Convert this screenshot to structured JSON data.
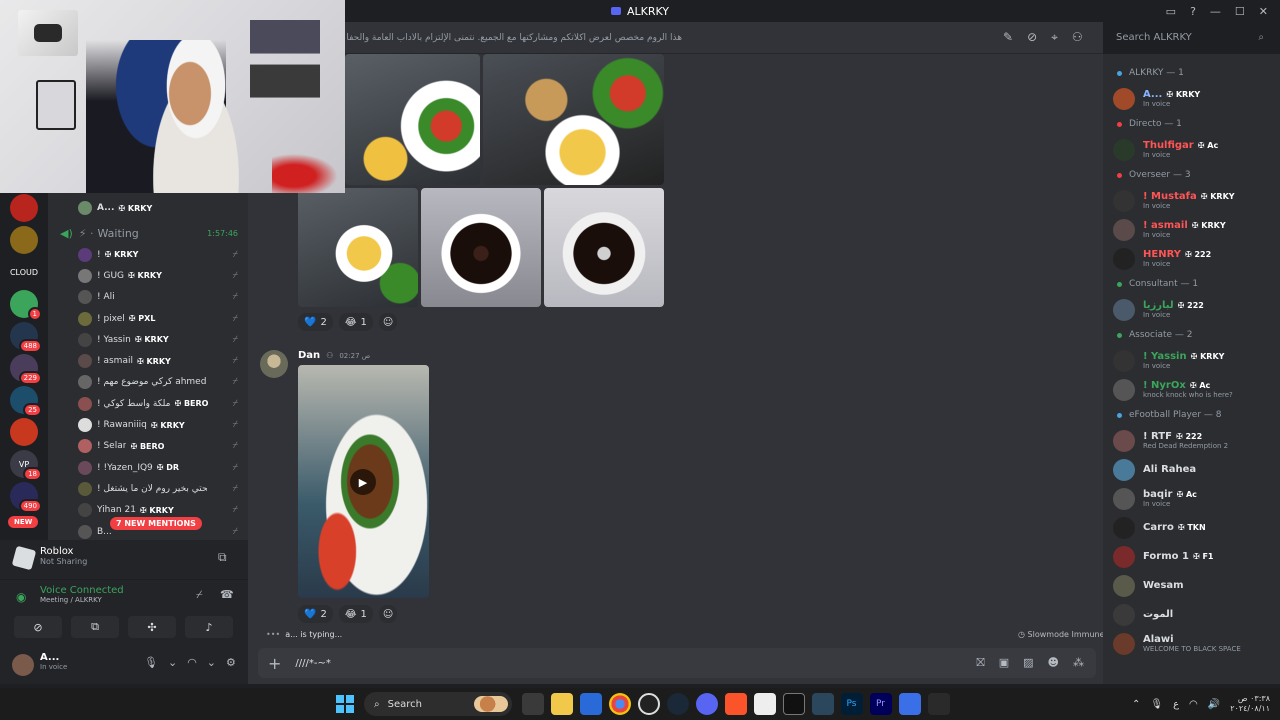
{
  "window": {
    "title": "ALKRKY"
  },
  "header": {
    "topic": "هذا الروم مخصص لعرض أكلاتكم ومشاركتها مع الجميع. نتمنى الإلتزام بالآداب العامة والحفاظ على جودة المحتوى.",
    "search_placeholder": "Search ALKRKY"
  },
  "guilds": [
    {
      "label": "",
      "badge": "",
      "color": "#b8241e"
    },
    {
      "label": "",
      "badge": "",
      "color": "#8a6a1a"
    },
    {
      "label": "CLOUD",
      "badge": "",
      "color": "#1e1f22"
    },
    {
      "label": "",
      "badge": "1",
      "color": "#3ba55c"
    },
    {
      "label": "",
      "badge": "488",
      "color": "#24354e"
    },
    {
      "label": "",
      "badge": "229",
      "color": "#4a3d5c"
    },
    {
      "label": "",
      "badge": "25",
      "color": "#1c4d6b"
    },
    {
      "label": "",
      "badge": "",
      "color": "#c8381e"
    },
    {
      "label": "VP",
      "badge": "18",
      "color": "#3b3b48"
    },
    {
      "label": "",
      "badge": "490",
      "color": "#2a2a5a"
    }
  ],
  "new_pill": "NEW",
  "mentions_pill": "7 NEW MENTIONS",
  "voice_channel": {
    "top_user": {
      "name": "A...",
      "tag": "KRKY"
    },
    "name": "Waiting",
    "timer": "1:57:46",
    "members": [
      {
        "name": "!",
        "tag": "KRKY",
        "color": "#5c3b7a"
      },
      {
        "name": "! GUG",
        "tag": "KRKY",
        "color": "#777"
      },
      {
        "name": "! Ali",
        "tag": "",
        "color": "#555"
      },
      {
        "name": "! pixel",
        "tag": "PXL",
        "color": "#6b6b3b"
      },
      {
        "name": "! Yassin",
        "tag": "KRKY",
        "color": "#444"
      },
      {
        "name": "! asmail",
        "tag": "KRKY",
        "color": "#5a4a4a"
      },
      {
        "name": "! كركي موضوع مهم ahmed7km",
        "tag": "",
        "color": "#666"
      },
      {
        "name": "! ملكة واسط كوكي",
        "tag": "BERO",
        "color": "#8a5050"
      },
      {
        "name": "! Rawaniiiq",
        "tag": "KRKY",
        "color": "#ddd"
      },
      {
        "name": "! Selar",
        "tag": "BERO",
        "color": "#b06060"
      },
      {
        "name": "! !Yazen_IQ9",
        "tag": "DR",
        "color": "#6a4a5a"
      },
      {
        "name": "! سمحتي بخير روم لان ما يشتغل",
        "tag": "",
        "color": "#5a5a3a"
      },
      {
        "name": "Yihan 21",
        "tag": "KRKY",
        "color": "#444"
      },
      {
        "name": "B...",
        "tag": "",
        "color": "#555"
      }
    ]
  },
  "activity": {
    "title": "Roblox",
    "subtitle": "Not Sharing"
  },
  "voice_status": {
    "title": "Voice Connected",
    "channel": "Meeting / ALKRKY"
  },
  "user_panel": {
    "name": "A...",
    "status": "In voice"
  },
  "messages": {
    "first_reactions": [
      {
        "emoji": "💙",
        "count": "2"
      },
      {
        "emoji": "😂",
        "count": "1"
      }
    ],
    "second_author": "Dan",
    "second_time": "ص 02:27",
    "second_reactions": [
      {
        "emoji": "💙",
        "count": "2"
      },
      {
        "emoji": "😂",
        "count": "1"
      }
    ]
  },
  "typing": "a... is typing...",
  "slowmode": "Slowmode Immune",
  "composer_text": "////*-~*",
  "member_list": [
    {
      "type": "cat",
      "label": "ALKRKY — 1",
      "color": "#4aa3df"
    },
    {
      "type": "m",
      "name": "A...",
      "tag": "KRKY",
      "sub": "In voice",
      "color": "#8ab4ff",
      "av": "#a04a2a"
    },
    {
      "type": "cat",
      "label": "Directo — 1",
      "color": "#f23f43"
    },
    {
      "type": "m",
      "name": "Thulfigar",
      "tag": "Ac",
      "sub": "In voice",
      "color": "#ff5555",
      "av": "#2a3a2a"
    },
    {
      "type": "cat",
      "label": "Overseer — 3",
      "color": "#f23f43"
    },
    {
      "type": "m",
      "name": "! Mustafa",
      "tag": "KRKY",
      "sub": "In voice",
      "color": "#ff5555",
      "av": "#333"
    },
    {
      "type": "m",
      "name": "! asmail",
      "tag": "KRKY",
      "sub": "In voice",
      "color": "#ff5555",
      "av": "#5a4a4a"
    },
    {
      "type": "m",
      "name": "HENRY",
      "tag": "222",
      "sub": "In voice",
      "color": "#ff5555",
      "av": "#222"
    },
    {
      "type": "cat",
      "label": "Consultant — 1",
      "color": "#3ba55c"
    },
    {
      "type": "m",
      "name": "لبارزيا",
      "tag": "222",
      "sub": "In voice",
      "color": "#3ba55c",
      "av": "#4a5a6a"
    },
    {
      "type": "cat",
      "label": "Associate — 2",
      "color": "#3ba55c"
    },
    {
      "type": "m",
      "name": "! Yassin",
      "tag": "KRKY",
      "sub": "In voice",
      "color": "#3ba55c",
      "av": "#333"
    },
    {
      "type": "m",
      "name": "! NyrOx",
      "tag": "Ac",
      "sub": "knock knock who is here?",
      "color": "#3ba55c",
      "av": "#555"
    },
    {
      "type": "cat",
      "label": "eFootball Player — 8",
      "color": "#4aa3df"
    },
    {
      "type": "m",
      "name": "! RTF",
      "tag": "222",
      "sub": "Red Dead Redemption 2",
      "color": "#dbdee1",
      "av": "#6a4a4a"
    },
    {
      "type": "m",
      "name": "Ali Rahea",
      "tag": "",
      "sub": "",
      "color": "#dbdee1",
      "av": "#4a7a9a"
    },
    {
      "type": "m",
      "name": "baqir",
      "tag": "Ac",
      "sub": "In voice",
      "color": "#dbdee1",
      "av": "#555"
    },
    {
      "type": "m",
      "name": "Carro",
      "tag": "TKN",
      "sub": "",
      "color": "#dbdee1",
      "av": "#222"
    },
    {
      "type": "m",
      "name": "Formo 1",
      "tag": "F1",
      "sub": "",
      "color": "#dbdee1",
      "av": "#7a2a2a"
    },
    {
      "type": "m",
      "name": "Wesam",
      "tag": "",
      "sub": "",
      "color": "#dbdee1",
      "av": "#5a5a4a"
    },
    {
      "type": "m",
      "name": "الموت",
      "tag": "",
      "sub": "",
      "color": "#dbdee1",
      "av": "#3a3a3a"
    },
    {
      "type": "m",
      "name": "Alawi",
      "tag": "",
      "sub": "WELCOME TO BLACK SPACE",
      "color": "#dbdee1",
      "av": "#6a3a2a"
    }
  ],
  "taskbar": {
    "search": "Search",
    "time": "٠٣:٣٨ ص",
    "date": "٢٠٢٤/٠٨/١١",
    "lang": "ع"
  },
  "colors": {
    "accent": "#5865f2",
    "red": "#f23f43",
    "green": "#3ba55c"
  }
}
